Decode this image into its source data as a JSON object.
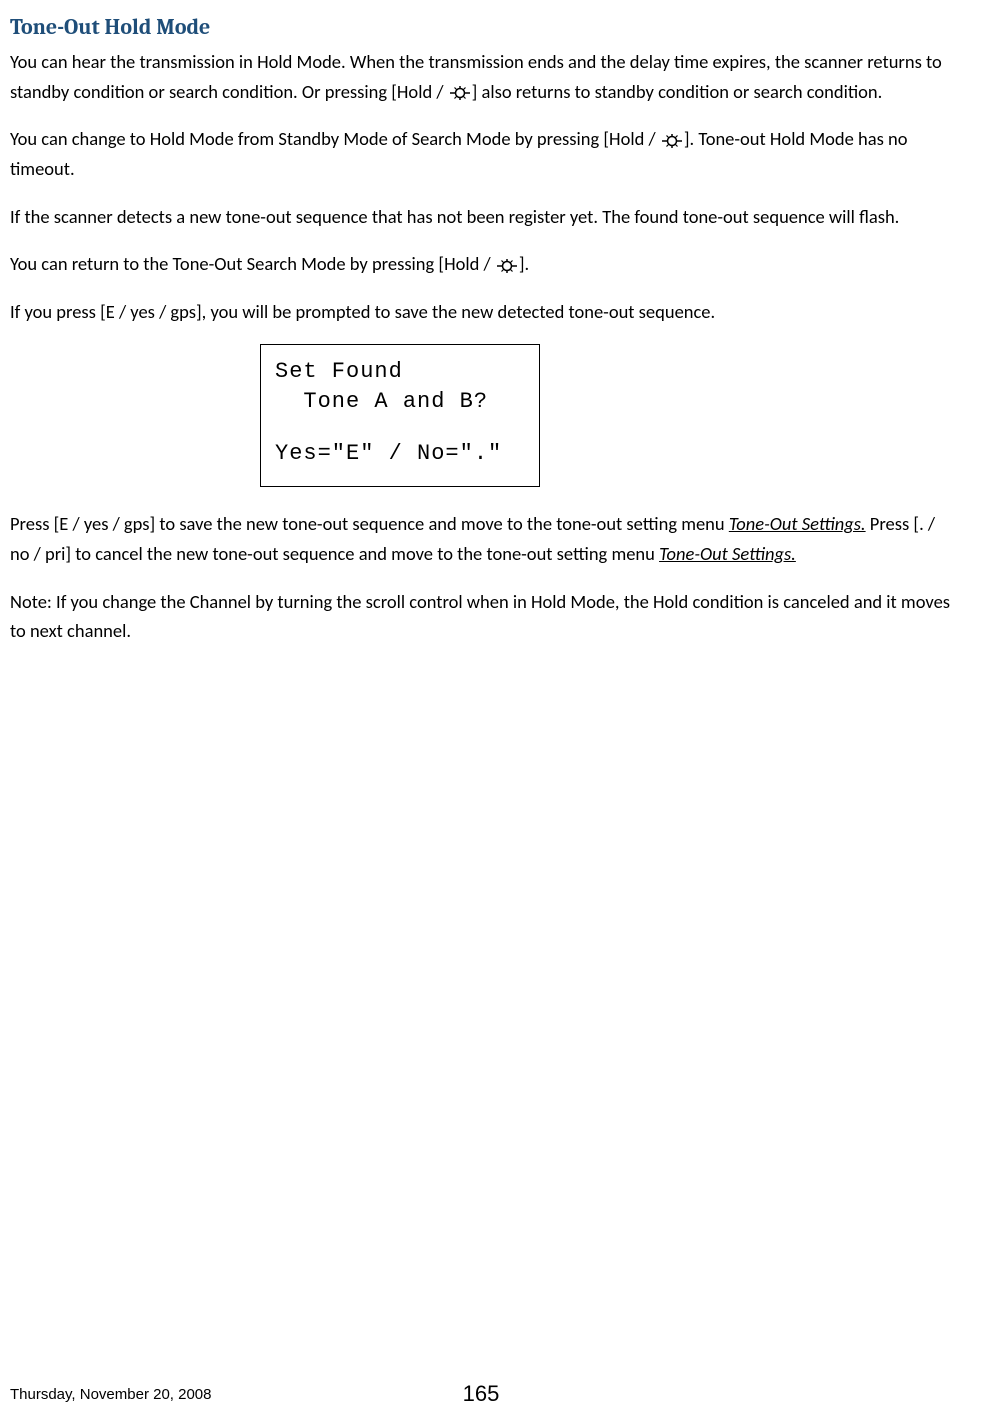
{
  "heading": "Tone-Out Hold Mode",
  "p1_a": "You can hear the transmission in Hold Mode. When the transmission ends and the delay time expires, the scanner returns to standby condition or search condition. Or pressing [Hold / ",
  "p1_b": "] also returns to standby condition or search condition.",
  "p2_a": "You  can change to Hold Mode from Standby Mode of Search Mode by pressing [Hold / ",
  "p2_b": "]. Tone-out Hold Mode has no timeout.",
  "p3": "If the scanner detects a new tone-out sequence that has not been register yet. The found tone-out sequence will flash.",
  "p4_a": "You  can return to the Tone-Out Search Mode by pressing [Hold / ",
  "p4_b": "].",
  "p5": "If you press [E / yes / gps], you will be prompted to save the new detected tone-out sequence.",
  "lcd": {
    "l1": "Set Found",
    "l2": "  Tone A and B?",
    "l3": "Yes=\"E\" / No=\".\""
  },
  "p6_a": "Press [E / yes / gps] to save the new tone-out sequence and move to the tone-out setting menu ",
  "p6_link1": "Tone-Out Settings.",
  "p6_b": " Press [. / no / pri] to cancel the new tone-out sequence and move to the tone-out setting menu ",
  "p6_link2": "Tone-Out Settings.",
  "p7": "Note: If you change the Channel by turning the scroll control when in Hold Mode, the Hold condition is canceled and it moves to next channel.",
  "footer": {
    "date": "Thursday, November 20, 2008",
    "page": "165"
  }
}
